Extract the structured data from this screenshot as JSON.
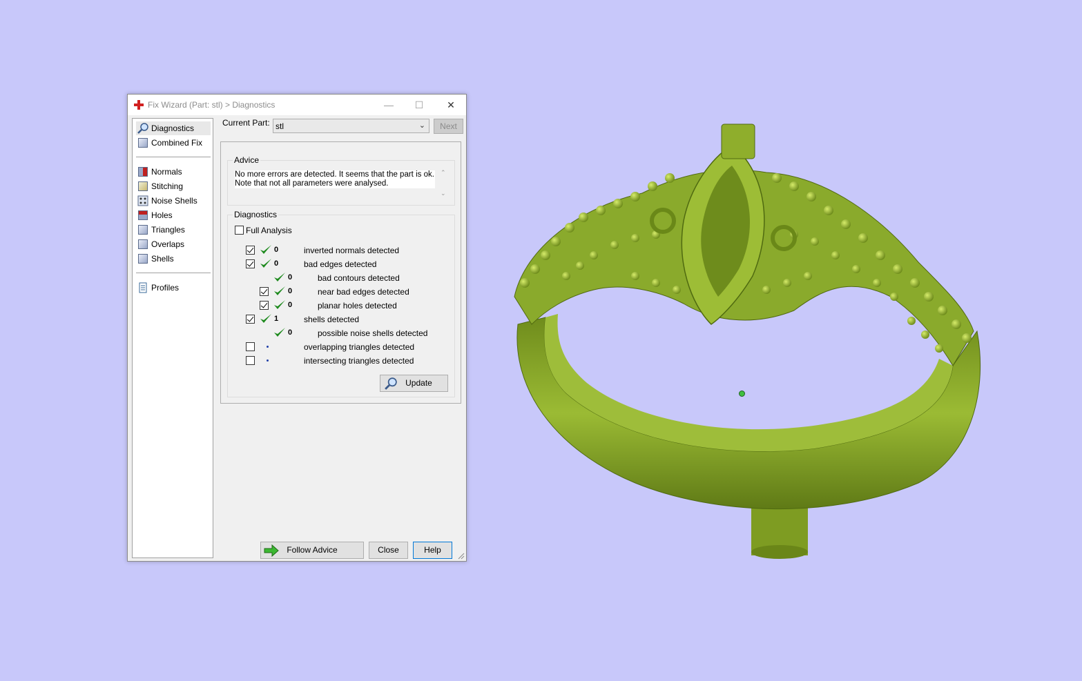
{
  "dialog": {
    "title": "Fix Wizard (Part: stl) > Diagnostics",
    "current_part_label": "Current Part:",
    "current_part_value": "stl",
    "next_label": "Next",
    "advice_title": "Advice",
    "advice_line1": "No more errors are detected. It seems that the part is ok.",
    "advice_line2": "Note that not all parameters were analysed.",
    "diagnostics_title": "Diagnostics",
    "full_analysis_label": "Full Analysis",
    "update_label": "Update",
    "follow_advice_label": "Follow Advice",
    "close_label": "Close",
    "help_label": "Help"
  },
  "sidebar": {
    "items": [
      {
        "label": "Diagnostics",
        "icon": "magnifier-icon"
      },
      {
        "label": "Combined Fix",
        "icon": "cube-icon"
      },
      {
        "label": "Normals",
        "icon": "cube-red-face-icon"
      },
      {
        "label": "Stitching",
        "icon": "cube-icon"
      },
      {
        "label": "Noise Shells",
        "icon": "dice-icon"
      },
      {
        "label": "Holes",
        "icon": "cube-red-top-icon"
      },
      {
        "label": "Triangles",
        "icon": "cube-icon"
      },
      {
        "label": "Overlaps",
        "icon": "cube-icon"
      },
      {
        "label": "Shells",
        "icon": "cube-icon"
      },
      {
        "label": "Profiles",
        "icon": "document-icon"
      }
    ]
  },
  "diagnostics": [
    {
      "checked": true,
      "has_check": true,
      "status": "ok",
      "count": "0",
      "label": "inverted normals detected"
    },
    {
      "checked": true,
      "has_check": true,
      "status": "ok",
      "count": "0",
      "label": "bad edges detected"
    },
    {
      "checked": false,
      "has_check": false,
      "status": "ok",
      "count": "0",
      "label": "bad contours detected"
    },
    {
      "checked": true,
      "has_check": true,
      "status": "ok",
      "count": "0",
      "label": "near bad edges detected"
    },
    {
      "checked": true,
      "has_check": true,
      "status": "ok",
      "count": "0",
      "label": "planar holes detected"
    },
    {
      "checked": true,
      "has_check": true,
      "status": "ok",
      "count": "1",
      "label": "shells detected"
    },
    {
      "checked": false,
      "has_check": false,
      "status": "ok",
      "count": "0",
      "label": "possible noise shells detected"
    },
    {
      "checked": false,
      "has_check": true,
      "status": "pending",
      "count": "",
      "label": "overlapping triangles detected"
    },
    {
      "checked": false,
      "has_check": true,
      "status": "pending",
      "count": "",
      "label": "intersecting triangles detected"
    }
  ],
  "colors": {
    "background": "#c8c8fa",
    "model": "#8fae2c",
    "tick": "#1e8a1e"
  }
}
